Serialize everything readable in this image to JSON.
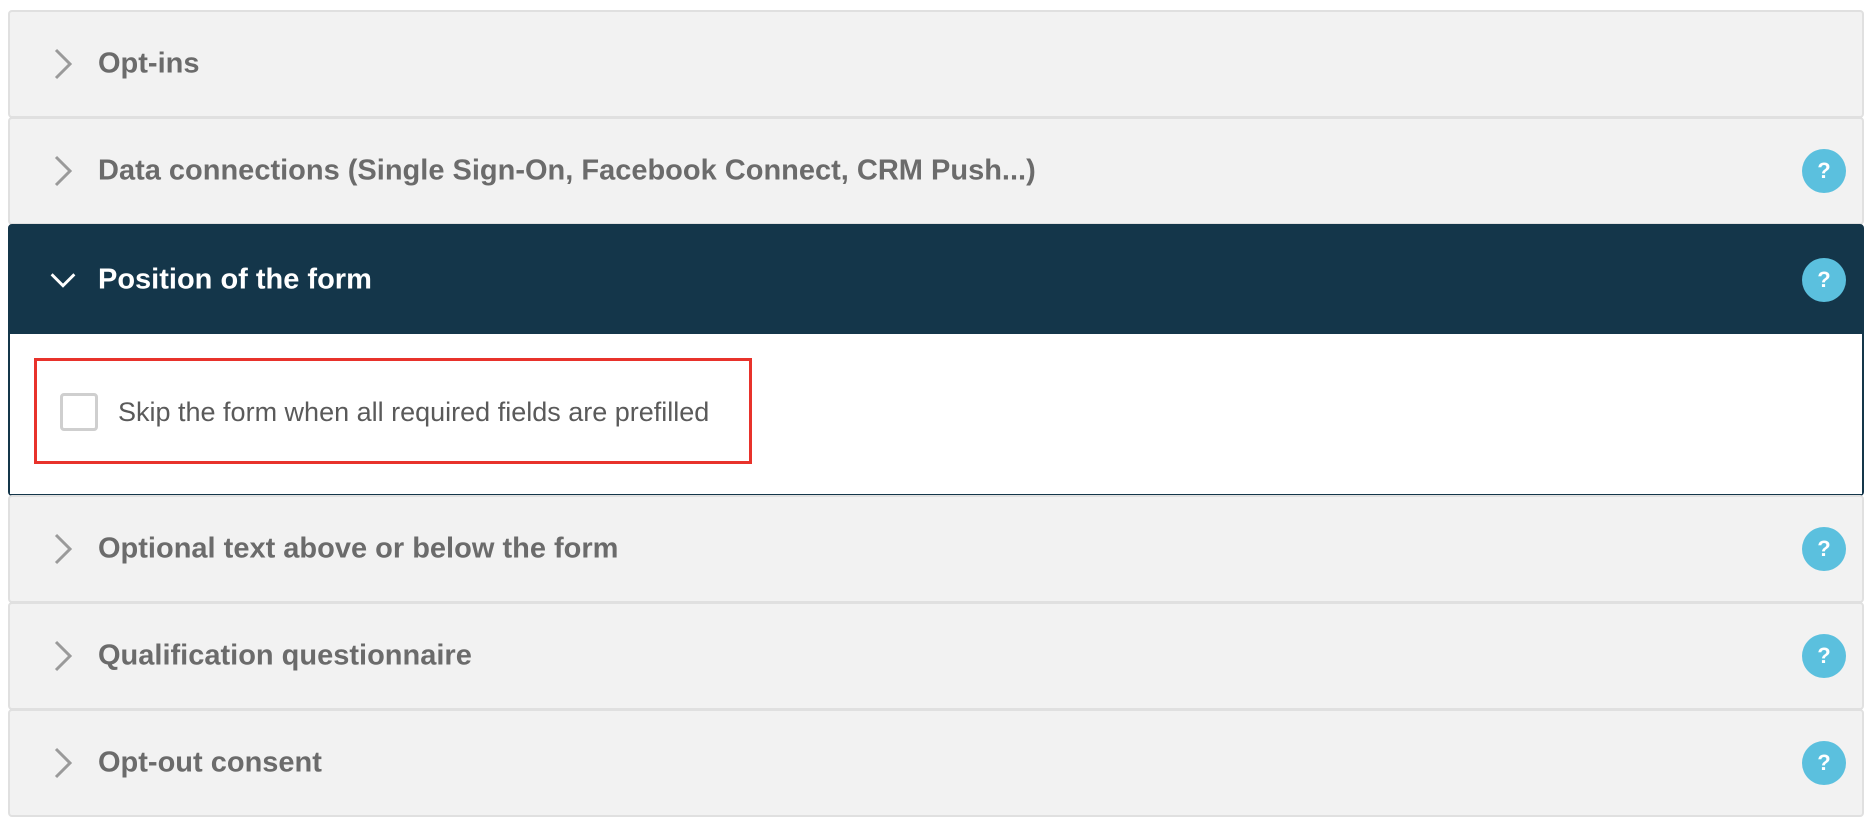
{
  "colors": {
    "panel_bg": "#f2f2f2",
    "active_header_bg": "#14364a",
    "help_icon_bg": "#5bc0de",
    "highlight_border": "#e8322b",
    "title_text": "#6b6b6b"
  },
  "panels": [
    {
      "title": "Opt-ins",
      "expanded": false,
      "has_help": false,
      "icon": "chevron-right-icon"
    },
    {
      "title": "Data connections (Single Sign-On, Facebook Connect, CRM Push...)",
      "expanded": false,
      "has_help": true,
      "help_label": "?",
      "icon": "chevron-right-icon"
    },
    {
      "title": "Position of the form",
      "expanded": true,
      "has_help": true,
      "help_label": "?",
      "icon": "chevron-down-icon",
      "body": {
        "checkbox_label": "Skip the form when all required fields are prefilled",
        "checked": false
      }
    },
    {
      "title": "Optional text above or below the form",
      "expanded": false,
      "has_help": true,
      "help_label": "?",
      "icon": "chevron-right-icon"
    },
    {
      "title": "Qualification questionnaire",
      "expanded": false,
      "has_help": true,
      "help_label": "?",
      "icon": "chevron-right-icon"
    },
    {
      "title": "Opt-out consent",
      "expanded": false,
      "has_help": true,
      "help_label": "?",
      "icon": "chevron-right-icon"
    }
  ]
}
